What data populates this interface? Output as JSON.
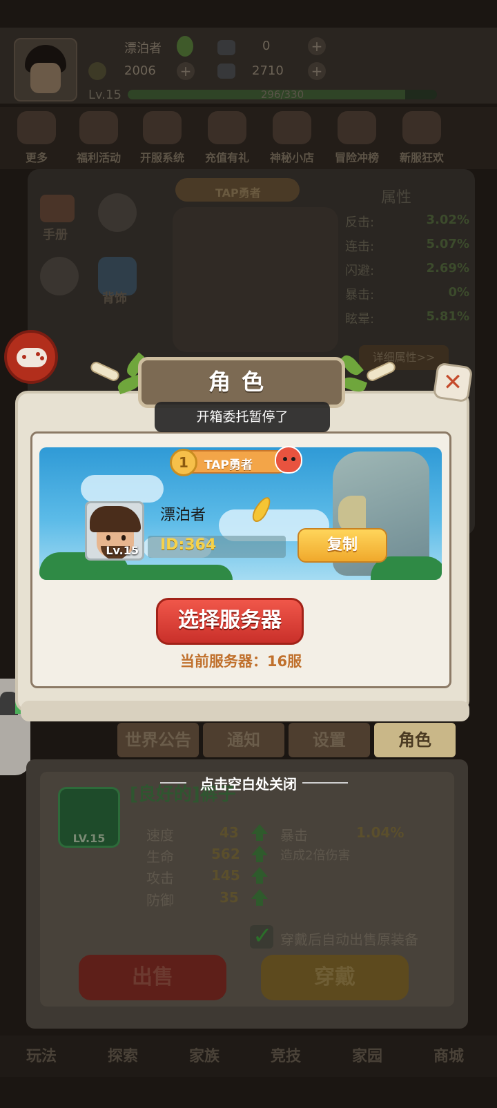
{
  "background": {
    "player_name": "漂泊者",
    "currency_top_right": "0",
    "gold": "2006",
    "gems": "2710",
    "level": "Lv.15",
    "xp": "296/330",
    "xp_fraction": 0.897,
    "menu": [
      "更多",
      "福利活动",
      "开服系统",
      "充值有礼",
      "神秘小店",
      "冒险冲榜",
      "新服狂欢"
    ],
    "left_items": [
      "手册",
      "",
      "",
      "背饰"
    ],
    "hero_title": "TAP勇者",
    "attr_header": "属性",
    "attributes": [
      {
        "label": "反击:",
        "value": "3.02%"
      },
      {
        "label": "连击:",
        "value": "5.07%"
      },
      {
        "label": "闪避:",
        "value": "2.69%"
      },
      {
        "label": "暴击:",
        "value": "0%"
      },
      {
        "label": "眩晕:",
        "value": "5.81%"
      }
    ],
    "detail_button": "详细属性>>",
    "tabs": [
      "世界公告",
      "通知",
      "设置",
      "角色"
    ],
    "active_tab": "角色",
    "item": {
      "name": "[良好的]裤子",
      "level": "LV.15",
      "stats": [
        {
          "label": "速度",
          "value": "43"
        },
        {
          "label": "生命",
          "value": "562"
        },
        {
          "label": "攻击",
          "value": "145"
        },
        {
          "label": "防御",
          "value": "35"
        }
      ],
      "crit_label": "暴击",
      "crit_value": "1.04%",
      "crit_desc": "造成2倍伤害"
    },
    "auto_sell_label": "穿戴后自动出售原装备",
    "sell_button": "出售",
    "wear_button": "穿戴",
    "bottom_nav": [
      "玩法",
      "探索",
      "家族",
      "竞技",
      "家园",
      "商城"
    ]
  },
  "modal": {
    "title": "角色",
    "toast": "开箱委托暂停了",
    "rank": "1",
    "hero_title": "TAP勇者",
    "player_name": "漂泊者",
    "player_level": "Lv.15",
    "player_id": "ID:364",
    "copy_button": "复制",
    "select_server_button": "选择服务器",
    "current_server": "当前服务器：16服",
    "close_hint": "点击空白处关闭"
  },
  "colors": {
    "accent_red": "#c9302a",
    "accent_gold": "#f0a92c",
    "modal_bg": "#f3efe6"
  }
}
